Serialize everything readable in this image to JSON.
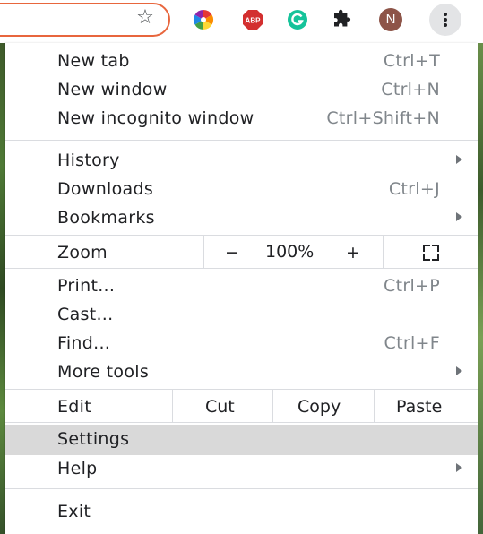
{
  "toolbar": {
    "avatar_initial": "N",
    "extensions": [
      "color-picker-icon",
      "adblock-icon",
      "grammarly-icon",
      "extensions-puzzle-icon"
    ]
  },
  "menu": {
    "groups": [
      [
        {
          "label": "New tab",
          "shortcut": "Ctrl+T"
        },
        {
          "label": "New window",
          "shortcut": "Ctrl+N"
        },
        {
          "label": "New incognito window",
          "shortcut": "Ctrl+Shift+N"
        }
      ],
      [
        {
          "label": "History",
          "shortcut": ""
        },
        {
          "label": "Downloads",
          "shortcut": "Ctrl+J"
        },
        {
          "label": "Bookmarks",
          "shortcut": ""
        }
      ]
    ],
    "zoom": {
      "label": "Zoom",
      "minus": "−",
      "value": "100%",
      "plus": "+"
    },
    "tools": [
      {
        "label": "Print...",
        "shortcut": "Ctrl+P"
      },
      {
        "label": "Cast...",
        "shortcut": ""
      },
      {
        "label": "Find...",
        "shortcut": "Ctrl+F"
      },
      {
        "label": "More tools",
        "shortcut": ""
      }
    ],
    "edit": {
      "label": "Edit",
      "cut": "Cut",
      "copy": "Copy",
      "paste": "Paste"
    },
    "settings": {
      "label": "Settings"
    },
    "help": {
      "label": "Help"
    },
    "exit": {
      "label": "Exit"
    }
  },
  "colors": {
    "highlight": "#d9d9d9",
    "omnibox_border": "#e8663d",
    "avatar": "#8d5448",
    "shortcut_text": "#80868b"
  }
}
